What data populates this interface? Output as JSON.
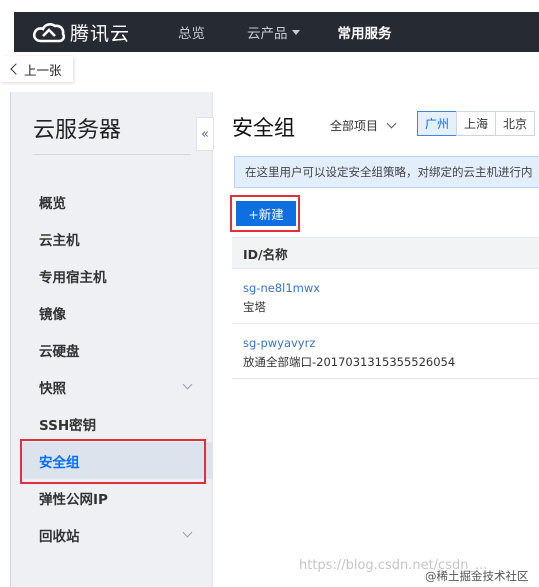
{
  "topbar": {
    "brand": "腾讯云",
    "nav": [
      {
        "label": "总览"
      },
      {
        "label": "云产品"
      },
      {
        "label": "常用服务"
      }
    ]
  },
  "back": {
    "label": "上一张"
  },
  "sidebar": {
    "title": "云服务器",
    "collapse_glyph": "«",
    "items": [
      {
        "label": "概览"
      },
      {
        "label": "云主机"
      },
      {
        "label": "专用宿主机"
      },
      {
        "label": "镜像"
      },
      {
        "label": "云硬盘"
      },
      {
        "label": "快照"
      },
      {
        "label": "SSH密钥"
      },
      {
        "label": "安全组"
      },
      {
        "label": "弹性公网IP"
      },
      {
        "label": "回收站"
      }
    ]
  },
  "main": {
    "title": "安全组",
    "project_select": "全部项目",
    "regions": [
      {
        "label": "广州"
      },
      {
        "label": "上海"
      },
      {
        "label": "北京"
      }
    ],
    "notice": "在这里用户可以设定安全组策略，对绑定的云主机进行内",
    "new_button": "+新建",
    "table": {
      "header": "ID/名称",
      "rows": [
        {
          "id": "sg-ne8l1mwx",
          "name": "宝塔"
        },
        {
          "id": "sg-pwyavyrz",
          "name": "放通全部端口-2017031315355526054"
        }
      ]
    }
  },
  "watermark": "https://blog.csdn.net/csdn_...",
  "watermark2": "@稀土掘金技术社区",
  "colors": {
    "accent": "#006eff",
    "topbar": "#262a33",
    "highlight": "#e0303a"
  }
}
